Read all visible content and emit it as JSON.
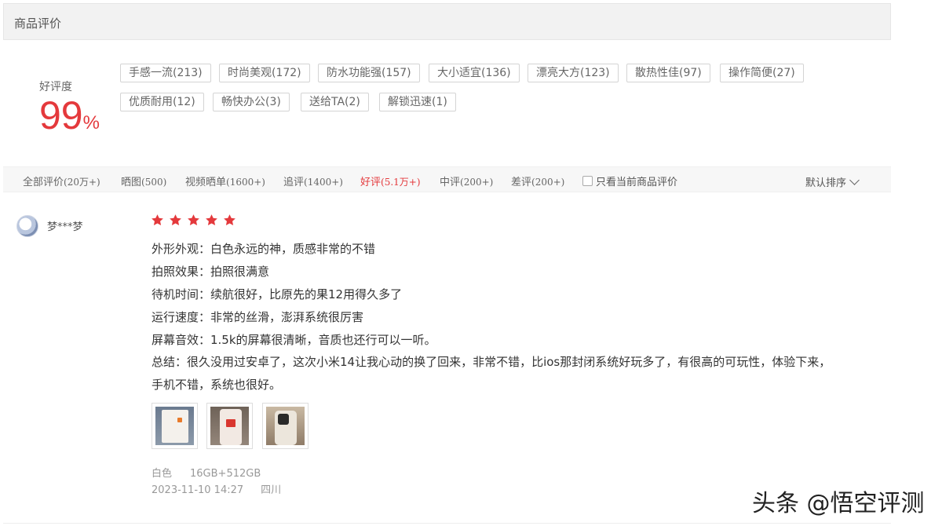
{
  "header": {
    "title": "商品评价"
  },
  "rating": {
    "label": "好评度",
    "value": "99",
    "unit": "%"
  },
  "tags": [
    "手感一流(213)",
    "时尚美观(172)",
    "防水功能强(157)",
    "大小适宜(136)",
    "漂亮大方(123)",
    "散热性佳(97)",
    "操作简便(27)",
    "优质耐用(12)",
    "畅快办公(3)",
    "送给TA(2)",
    "解锁迅速(1)"
  ],
  "tabs": [
    {
      "label": "全部评价",
      "count": "(20万+)"
    },
    {
      "label": "晒图",
      "count": "(500)"
    },
    {
      "label": "视频晒单",
      "count": "(1600+)"
    },
    {
      "label": "追评",
      "count": "(1400+)"
    },
    {
      "label": "好评",
      "count": "(5.1万+)"
    },
    {
      "label": "中评",
      "count": "(200+)"
    },
    {
      "label": "差评",
      "count": "(200+)"
    }
  ],
  "filter_checkbox": {
    "label": "只看当前商品评价",
    "checked": false
  },
  "sort": {
    "label": "默认排序"
  },
  "review": {
    "username": "梦***梦",
    "stars": 5,
    "lines": [
      "外形外观：白色永远的神，质感非常的不错",
      "拍照效果：拍照很满意",
      "待机时间：续航很好，比原先的果12用得久多了",
      "运行速度：非常的丝滑，澎湃系统很厉害",
      "屏幕音效：1.5k的屏幕很清晰，音质也还行可以一听。",
      "总结：很久没用过安卓了，这次小米14让我心动的换了回来，非常不错，比ios那封闭系统好玩多了，有很高的可玩性，体验下来，",
      "手机不错，系统也很好。"
    ],
    "color": "白色",
    "spec": "16GB+512GB",
    "datetime": "2023-11-10 14:27",
    "location": "四川"
  },
  "watermark": "头条 @悟空评测",
  "colors": {
    "accent": "#e4393c"
  }
}
